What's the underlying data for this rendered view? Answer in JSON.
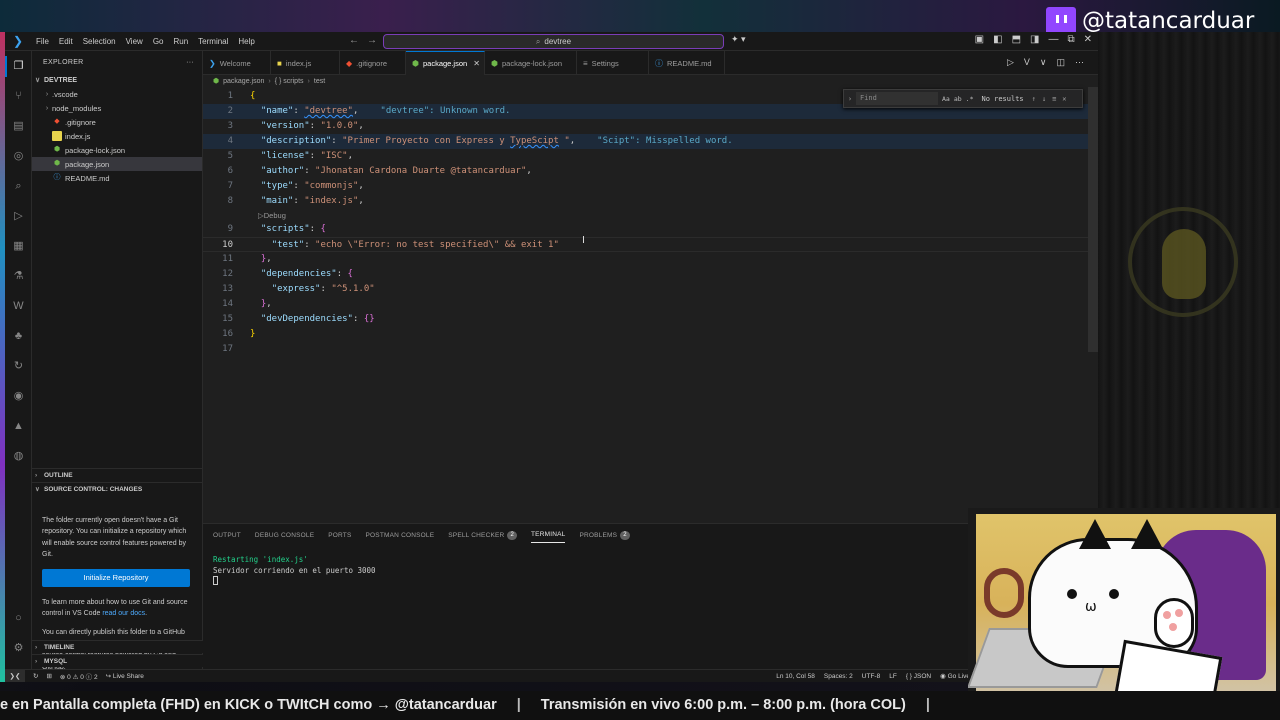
{
  "overlay": {
    "twitch_handle": "@tatancarduar",
    "ticker_left": "e en Pantalla completa (FHD)  en KICK  o TWItCH como → @tatancarduar",
    "ticker_sep": "|",
    "ticker_right": "Transmisión en vivo  6:00 p.m. – 8:00 p.m. (hora COL)",
    "ticker_sep2": "|"
  },
  "menu": [
    "File",
    "Edit",
    "Selection",
    "View",
    "Go",
    "Run",
    "Terminal",
    "Help"
  ],
  "command_center": "devtree",
  "explorer": {
    "title": "EXPLORER",
    "more": "···",
    "folder": "DEVTREE",
    "items": [
      {
        "name": ".vscode",
        "type": "folder"
      },
      {
        "name": "node_modules",
        "type": "folder"
      },
      {
        "name": ".gitignore",
        "type": "git"
      },
      {
        "name": "index.js",
        "type": "js"
      },
      {
        "name": "package-lock.json",
        "type": "json"
      },
      {
        "name": "package.json",
        "type": "json",
        "selected": true
      },
      {
        "name": "README.md",
        "type": "info"
      }
    ]
  },
  "outline": "OUTLINE",
  "source_control": {
    "title": "SOURCE CONTROL: CHANGES",
    "p1": "The folder currently open doesn't have a Git repository. You can initialize a repository which will enable source control features powered by Git.",
    "button": "Initialize Repository",
    "p2a": "To learn more about how to use Git and source control in VS Code ",
    "p2link": "read our docs",
    "p2b": ".",
    "p3": "You can directly publish this folder to a GitHub repository. Once published, you'll have access to source control features powered by Git and GitHub."
  },
  "timeline": "TIMELINE",
  "mysql": "MYSQL",
  "tabs": [
    {
      "label": "Welcome",
      "icon": "vscode-icon"
    },
    {
      "label": "index.js",
      "icon": "js-icon"
    },
    {
      "label": ".gitignore",
      "icon": "git-icon"
    },
    {
      "label": "package.json",
      "icon": "json-icon",
      "active": true
    },
    {
      "label": "package-lock.json",
      "icon": "json-icon"
    },
    {
      "label": "Settings",
      "icon": "settings-icon"
    },
    {
      "label": "README.md",
      "icon": "info-icon"
    }
  ],
  "breadcrumb": [
    "package.json",
    "{ } scripts",
    "test"
  ],
  "find": {
    "placeholder": "Find",
    "opt1": "Aa",
    "opt2": "ab",
    "opt3": ".*",
    "result": "No results"
  },
  "editor": {
    "lines": [
      "1",
      "2",
      "3",
      "4",
      "5",
      "6",
      "7",
      "8",
      "9",
      "10",
      "11",
      "12",
      "13",
      "14",
      "15",
      "16",
      "17"
    ],
    "current_line": "10",
    "codelens": "▷Debug",
    "name_key": "\"name\"",
    "name_val": "\"devtree\"",
    "diag1": "\"devtree\": Unknown word.",
    "version_key": "\"version\"",
    "version_val": "\"1.0.0\"",
    "desc_key": "\"description\"",
    "desc_val_a": "\"Primer Proyecto con Express y ",
    "desc_val_b": "TypeScipt",
    "desc_val_c": " \"",
    "diag2": "\"Scipt\": Misspelled word.",
    "license_key": "\"license\"",
    "license_val": "\"ISC\"",
    "author_key": "\"author\"",
    "author_val": "\"Jhonatan Cardona Duarte @tatancarduar\"",
    "type_key": "\"type\"",
    "type_val": "\"commonjs\"",
    "main_key": "\"main\"",
    "main_val": "\"index.js\"",
    "scripts_key": "\"scripts\"",
    "test_key": "\"test\"",
    "test_val": "\"echo \\\"Error: no test specified\\\" && exit 1\"",
    "deps_key": "\"dependencies\"",
    "express_key": "\"express\"",
    "express_val": "\"^5.1.0\"",
    "devdeps_key": "\"devDependencies\""
  },
  "panel": {
    "tabs": [
      {
        "label": "OUTPUT"
      },
      {
        "label": "DEBUG CONSOLE"
      },
      {
        "label": "PORTS"
      },
      {
        "label": "POSTMAN CONSOLE"
      },
      {
        "label": "SPELL CHECKER",
        "badge": "2"
      },
      {
        "label": "TERMINAL",
        "active": true
      },
      {
        "label": "PROBLEMS",
        "badge": "2"
      }
    ],
    "terminal_lines": [
      "Restarting 'index.js'",
      "Servidor corriendo en el puerto 3000"
    ]
  },
  "status": {
    "errors": "⊗ 0 ⚠ 0 ⓘ 2",
    "liveshare": "Live Share",
    "position": "Ln 10, Col 58",
    "spaces": "Spaces: 2",
    "encoding": "UTF-8",
    "eol": "LF",
    "language": "{ } JSON",
    "golive": "Go Live"
  },
  "colors": {
    "accent": "#0078d4",
    "command_border": "#7a3db8",
    "twitch": "#9146ff"
  }
}
